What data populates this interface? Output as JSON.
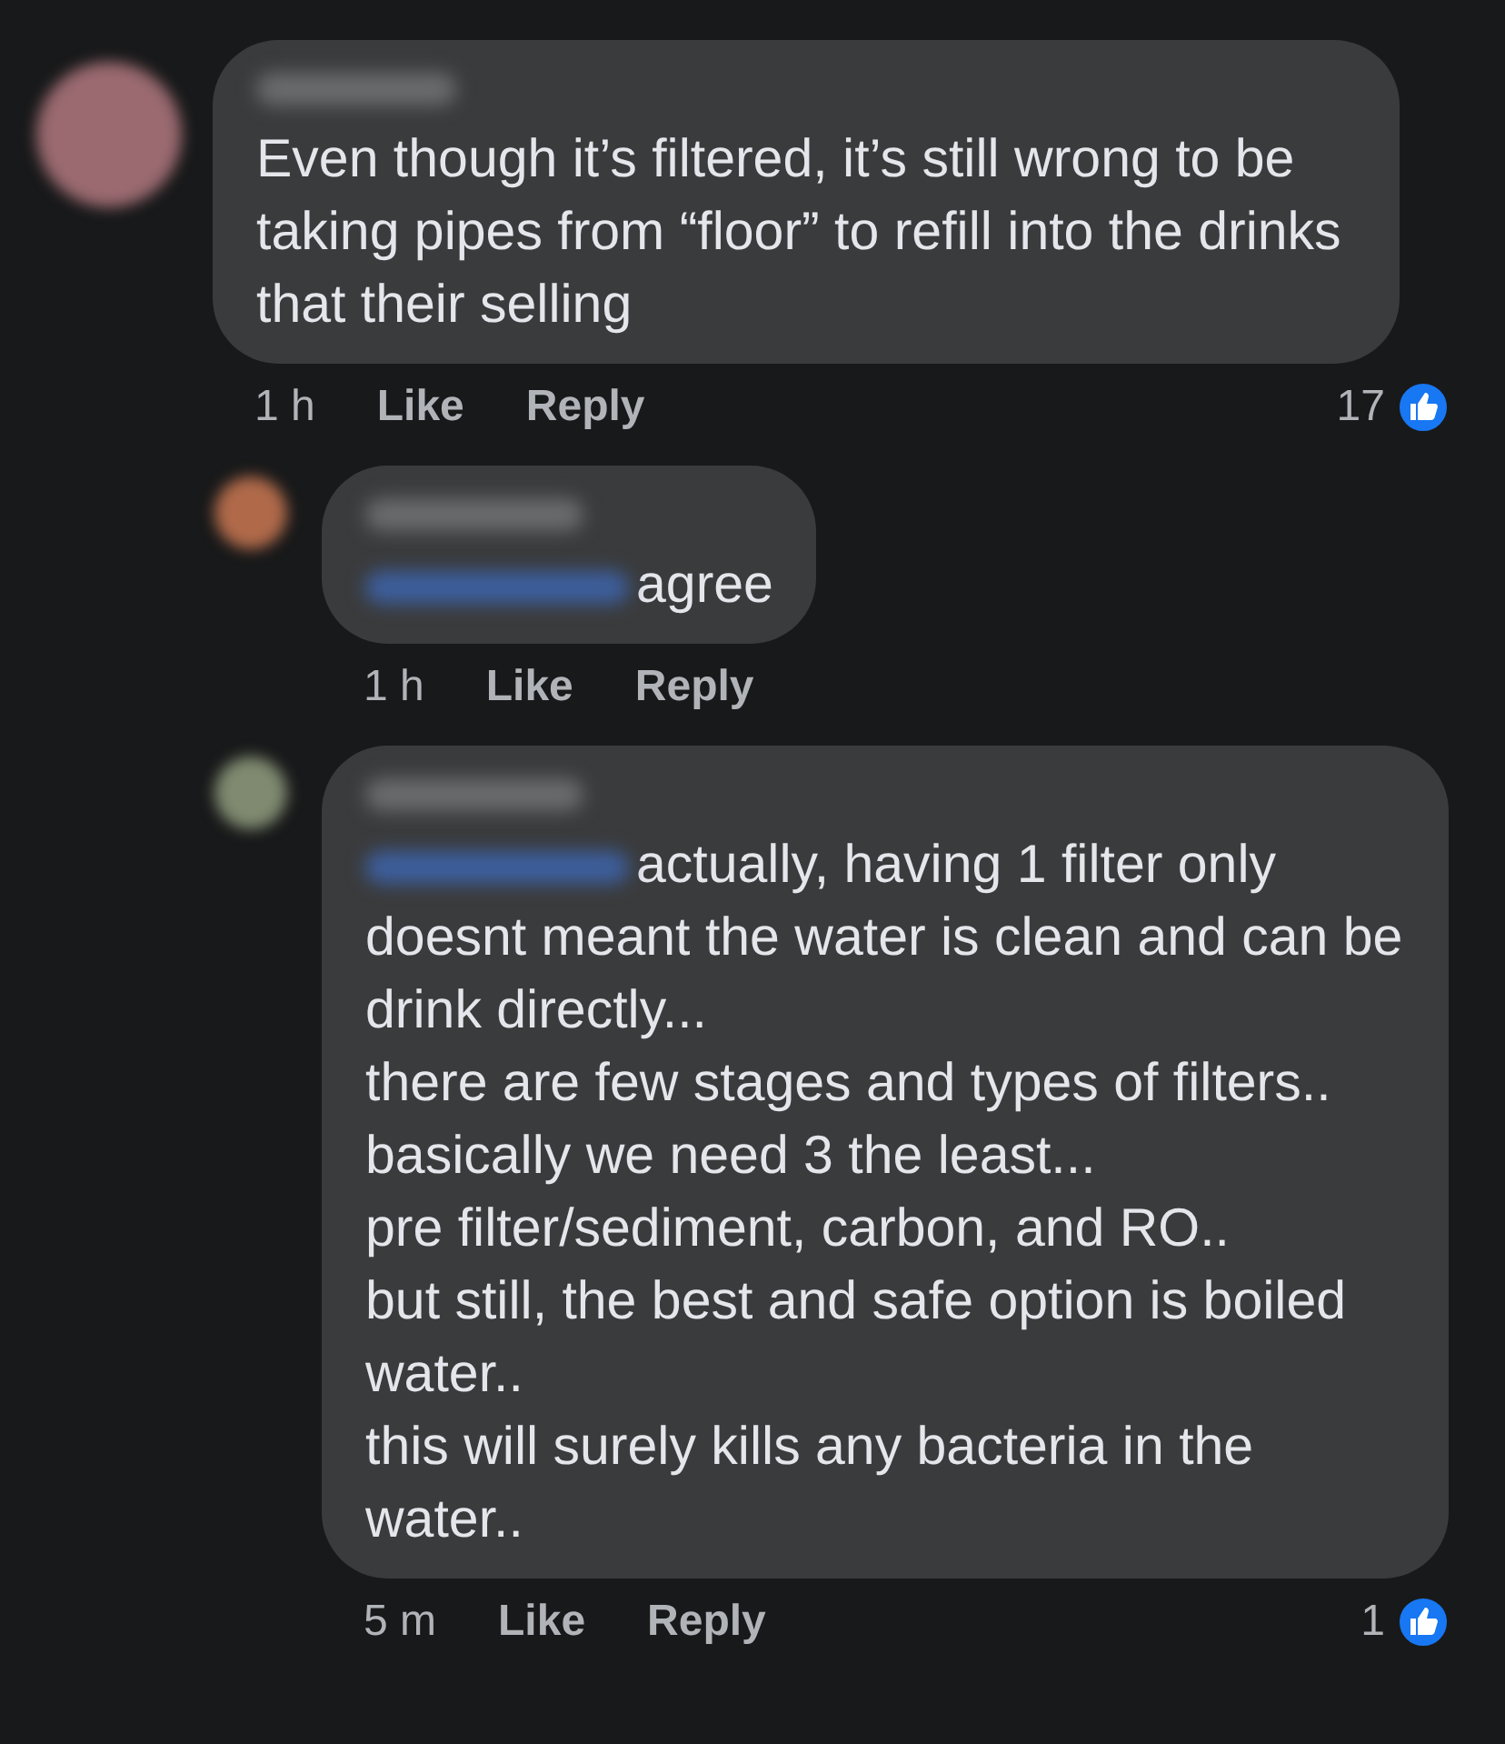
{
  "comments": [
    {
      "body": "Even though it’s filtered, it’s still wrong to be taking pipes from “floor” to refill into the drinks that their selling",
      "mention": false,
      "time": "1 h",
      "actions": [
        "Like",
        "Reply"
      ],
      "reactions": "17",
      "replies": [
        {
          "body": "agree",
          "mention": true,
          "time": "1 h",
          "actions": [
            "Like",
            "Reply"
          ]
        },
        {
          "body": "actually, having 1 filter only doesnt meant the water is clean and can be drink directly...\nthere are few stages and types of filters..\nbasically we need 3 the least...\npre filter/sediment, carbon, and RO..\nbut still, the best and safe option is boiled water..\nthis will surely kills any bacteria in the water..",
          "mention": true,
          "time": "5 m",
          "actions": [
            "Like",
            "Reply"
          ],
          "reactions": "1"
        }
      ]
    }
  ]
}
